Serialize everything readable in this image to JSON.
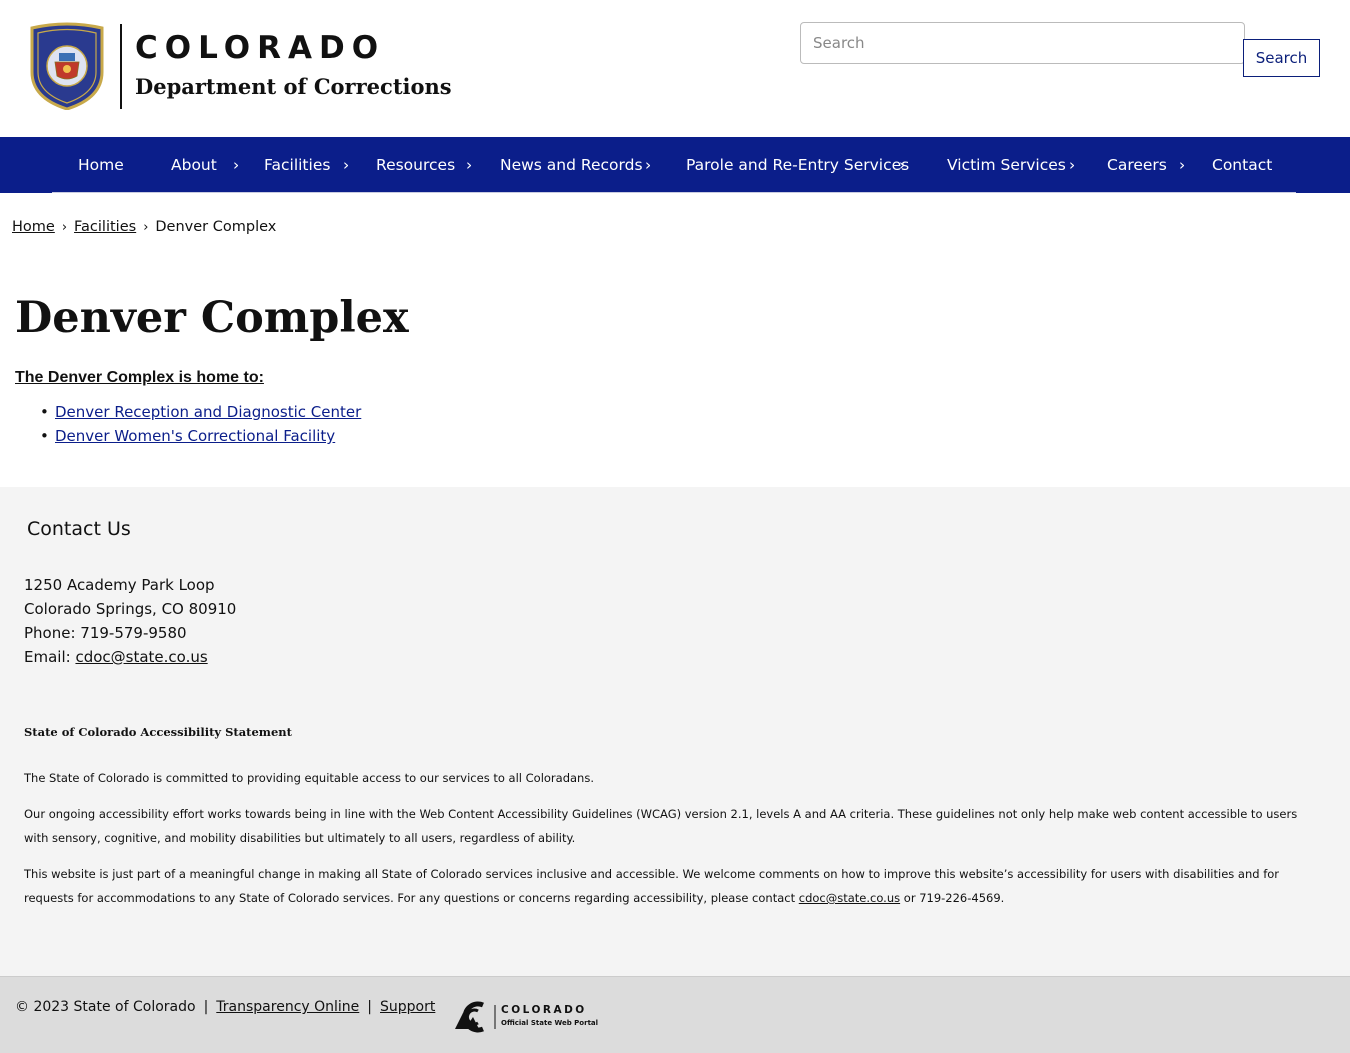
{
  "header": {
    "logo_title": "COLORADO",
    "logo_subtitle": "Department of Corrections",
    "search_placeholder": "Search",
    "search_button": "Search"
  },
  "nav": {
    "items": [
      {
        "label": "Home",
        "has_submenu": false
      },
      {
        "label": "About",
        "has_submenu": true
      },
      {
        "label": "Facilities",
        "has_submenu": true
      },
      {
        "label": "Resources",
        "has_submenu": true
      },
      {
        "label": "News and Records",
        "has_submenu": true
      },
      {
        "label": "Parole and Re-Entry Services",
        "has_submenu": true
      },
      {
        "label": "Victim Services",
        "has_submenu": true
      },
      {
        "label": "Careers",
        "has_submenu": true
      },
      {
        "label": "Contact",
        "has_submenu": false
      }
    ],
    "chevron": "›"
  },
  "breadcrumb": {
    "items": [
      "Home",
      "Facilities",
      "Denver Complex"
    ],
    "separator": "›"
  },
  "main": {
    "title": "Denver Complex",
    "intro": "The Denver Complex is home to:",
    "facilities": [
      "Denver Reception and Diagnostic Center",
      "Denver Women's Correctional Facility"
    ]
  },
  "footer": {
    "contact_heading": "Contact Us",
    "address_line1": "1250 Academy Park Loop",
    "address_line2": "Colorado Springs, CO 80910",
    "phone": "Phone: 719-579-9580",
    "email_label": "Email: ",
    "email": "cdoc@state.co.us",
    "accessibility_heading": "State of Colorado Accessibility Statement",
    "accessibility_p1": "The State of Colorado is committed to providing equitable access to our services to all Coloradans.",
    "accessibility_p2": "Our ongoing accessibility effort works towards being in line with the Web Content Accessibility Guidelines (WCAG) version 2.1, levels A and AA criteria. These guidelines not only help make web content accessible to users with sensory, cognitive, and mobility disabilities but ultimately to all users, regardless of ability.",
    "accessibility_p3_before": "This website is just part of a meaningful change in making all State of Colorado services inclusive and accessible. We welcome comments on how to improve this website’s accessibility for users with disabilities and for requests for accommodations to any State of Colorado services. For any questions or concerns regarding accessibility, please contact ",
    "accessibility_p3_email": "cdoc@state.co.us",
    "accessibility_p3_after": " or 719-226-4569."
  },
  "bottom": {
    "copyright": "© 2023 State of Colorado",
    "pipe": "|",
    "transparency": "Transparency Online",
    "support": "Support",
    "portal_title": "COLORADO",
    "portal_subtitle": "Official State Web Portal"
  },
  "colors": {
    "nav_bg": "#0b1e8a",
    "link": "#0b1e8a",
    "footer_bg": "#f4f4f4",
    "bottom_bg": "#dcdcdc"
  }
}
